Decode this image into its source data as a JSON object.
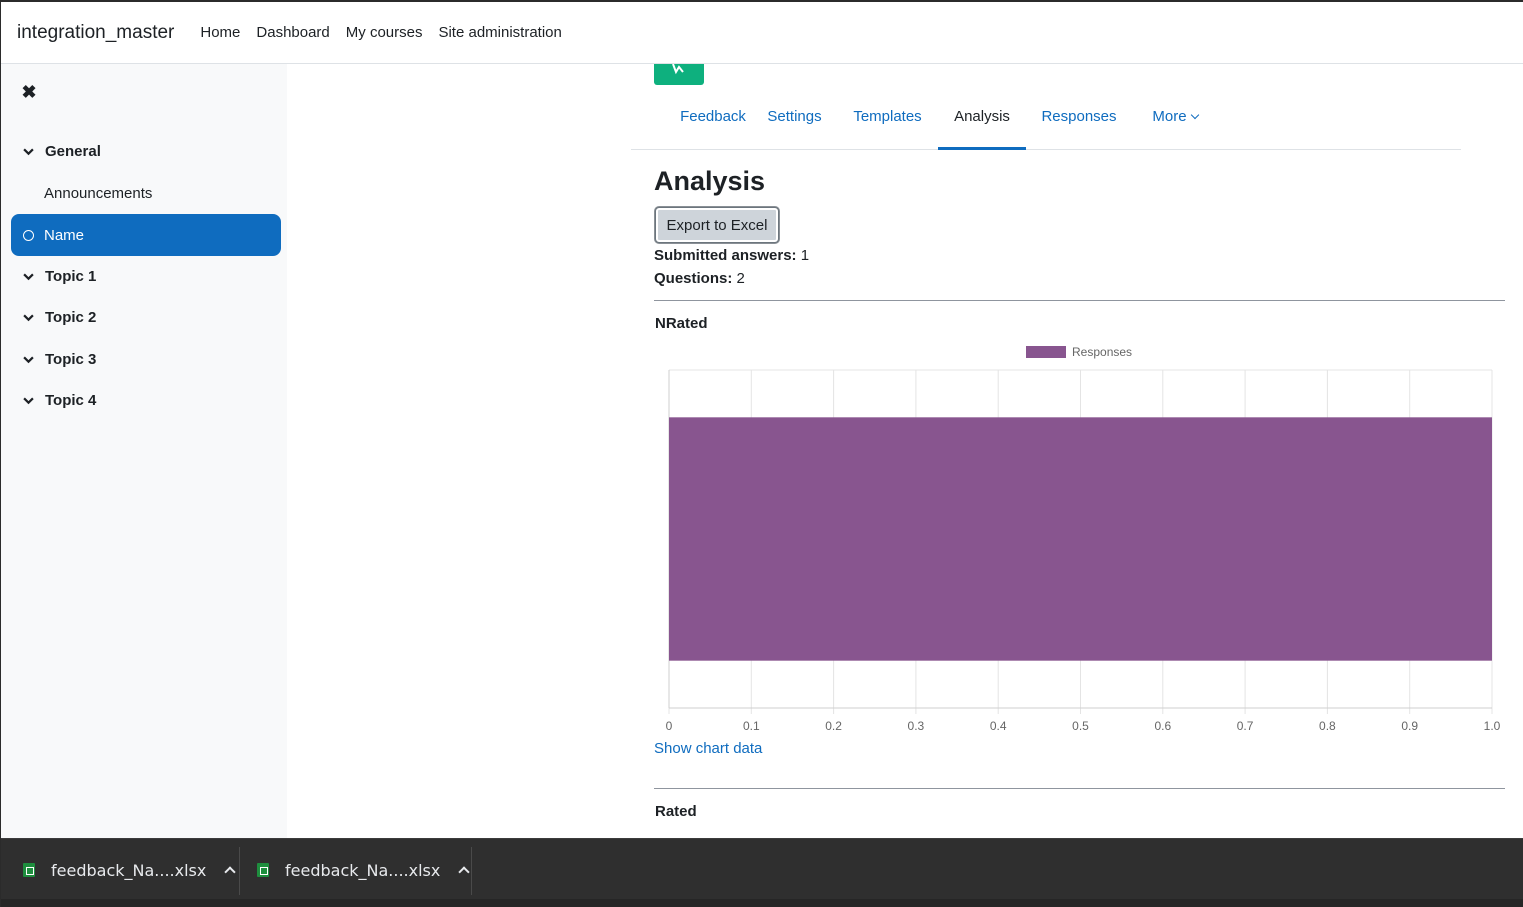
{
  "navbar": {
    "brand": "integration_master",
    "links": [
      "Home",
      "Dashboard",
      "My courses",
      "Site administration"
    ]
  },
  "drawer": {
    "close_icon": "✖",
    "sections": [
      {
        "label": "General"
      },
      {
        "label": "Topic 1"
      },
      {
        "label": "Topic 2"
      },
      {
        "label": "Topic 3"
      },
      {
        "label": "Topic 4"
      }
    ],
    "sub_item": "Announcements",
    "active_item": "Name"
  },
  "tabs": [
    "Feedback",
    "Settings",
    "Templates",
    "Analysis",
    "Responses",
    "More"
  ],
  "active_tab": "Analysis",
  "page": {
    "title": "Analysis",
    "export_label": "Export to Excel",
    "submitted_label": "Submitted answers:",
    "submitted_value": "1",
    "questions_label": "Questions:",
    "questions_value": "2",
    "show_chart_data": "Show chart data"
  },
  "questions": [
    {
      "title": "NRated"
    },
    {
      "title": "Rated"
    }
  ],
  "chart_data": {
    "type": "bar",
    "orientation": "horizontal",
    "title": "NRated",
    "categories": [
      ""
    ],
    "series": [
      {
        "name": "Responses",
        "values": [
          1
        ],
        "color": "#88558f"
      }
    ],
    "xlim": [
      0,
      1.0
    ],
    "xticks": [
      "0",
      "0.1",
      "0.2",
      "0.3",
      "0.4",
      "0.5",
      "0.6",
      "0.7",
      "0.8",
      "0.9",
      "1.0"
    ],
    "grid": true,
    "legend": "top-center"
  },
  "downloads": [
    {
      "name": "feedback_Na....xlsx"
    },
    {
      "name": "feedback_Na....xlsx"
    }
  ],
  "colors": {
    "primary": "#0f6cbf",
    "activity_green": "#0eb07e",
    "bar": "#88558f",
    "download_bar": "#2f2f2f"
  }
}
